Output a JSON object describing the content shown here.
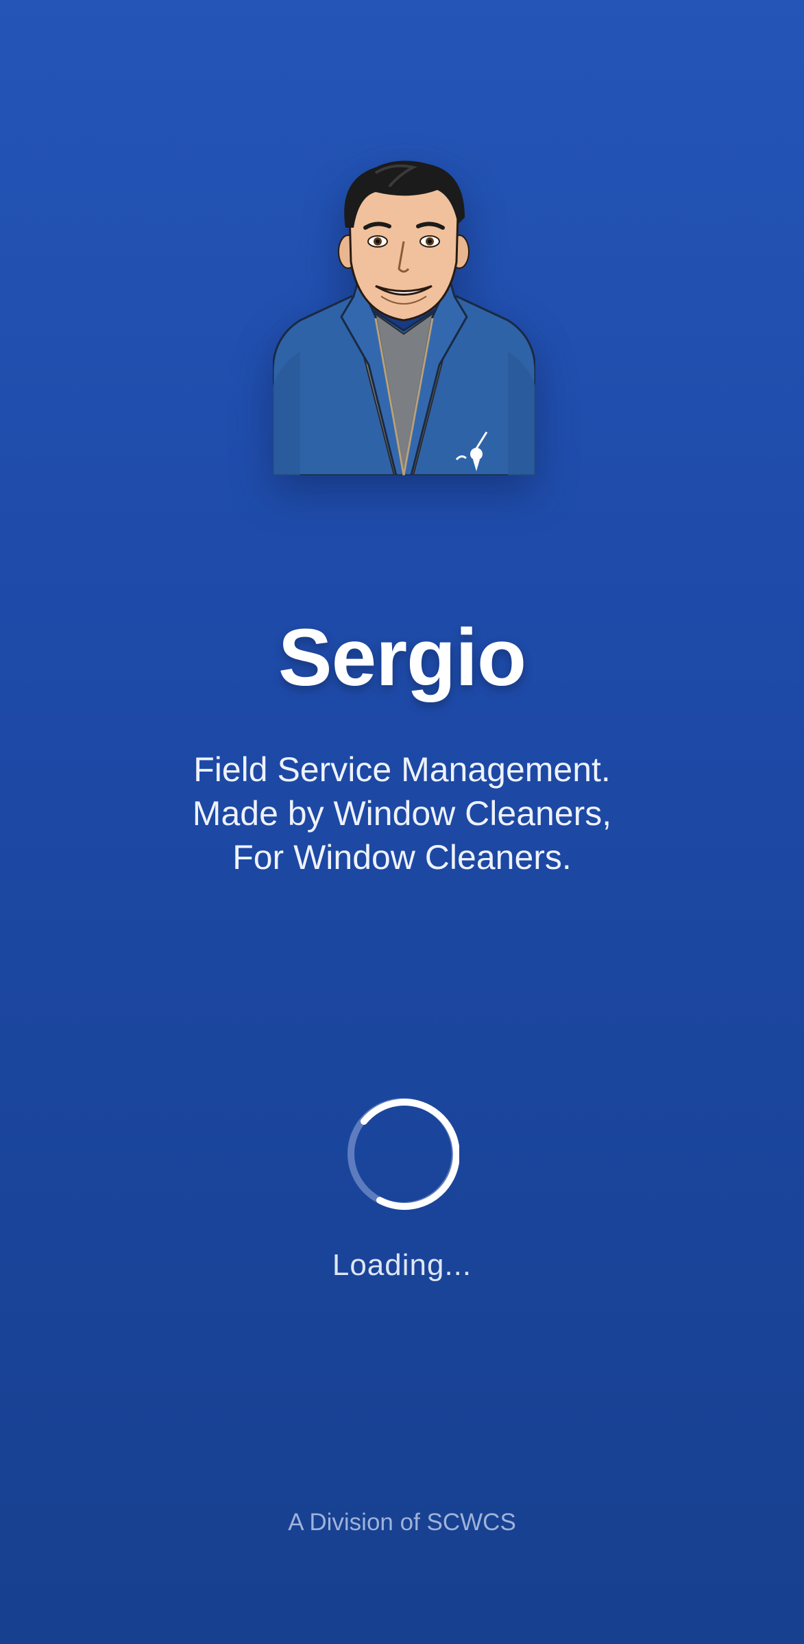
{
  "app": {
    "name": "Sergio",
    "tagline": [
      "Field Service Management.",
      "Made by Window Cleaners,",
      "For Window Cleaners."
    ]
  },
  "avatar": {
    "icon": "mascot-illustration"
  },
  "loading": {
    "label": "Loading...",
    "icon": "loading-spinner-icon"
  },
  "footer": {
    "division": "A Division of SCWCS"
  },
  "colors": {
    "background_top": "#2455b7",
    "background_bottom": "#17408f",
    "text": "#ffffff",
    "muted": "#9fb2da",
    "jacket": "#2f63a8"
  }
}
